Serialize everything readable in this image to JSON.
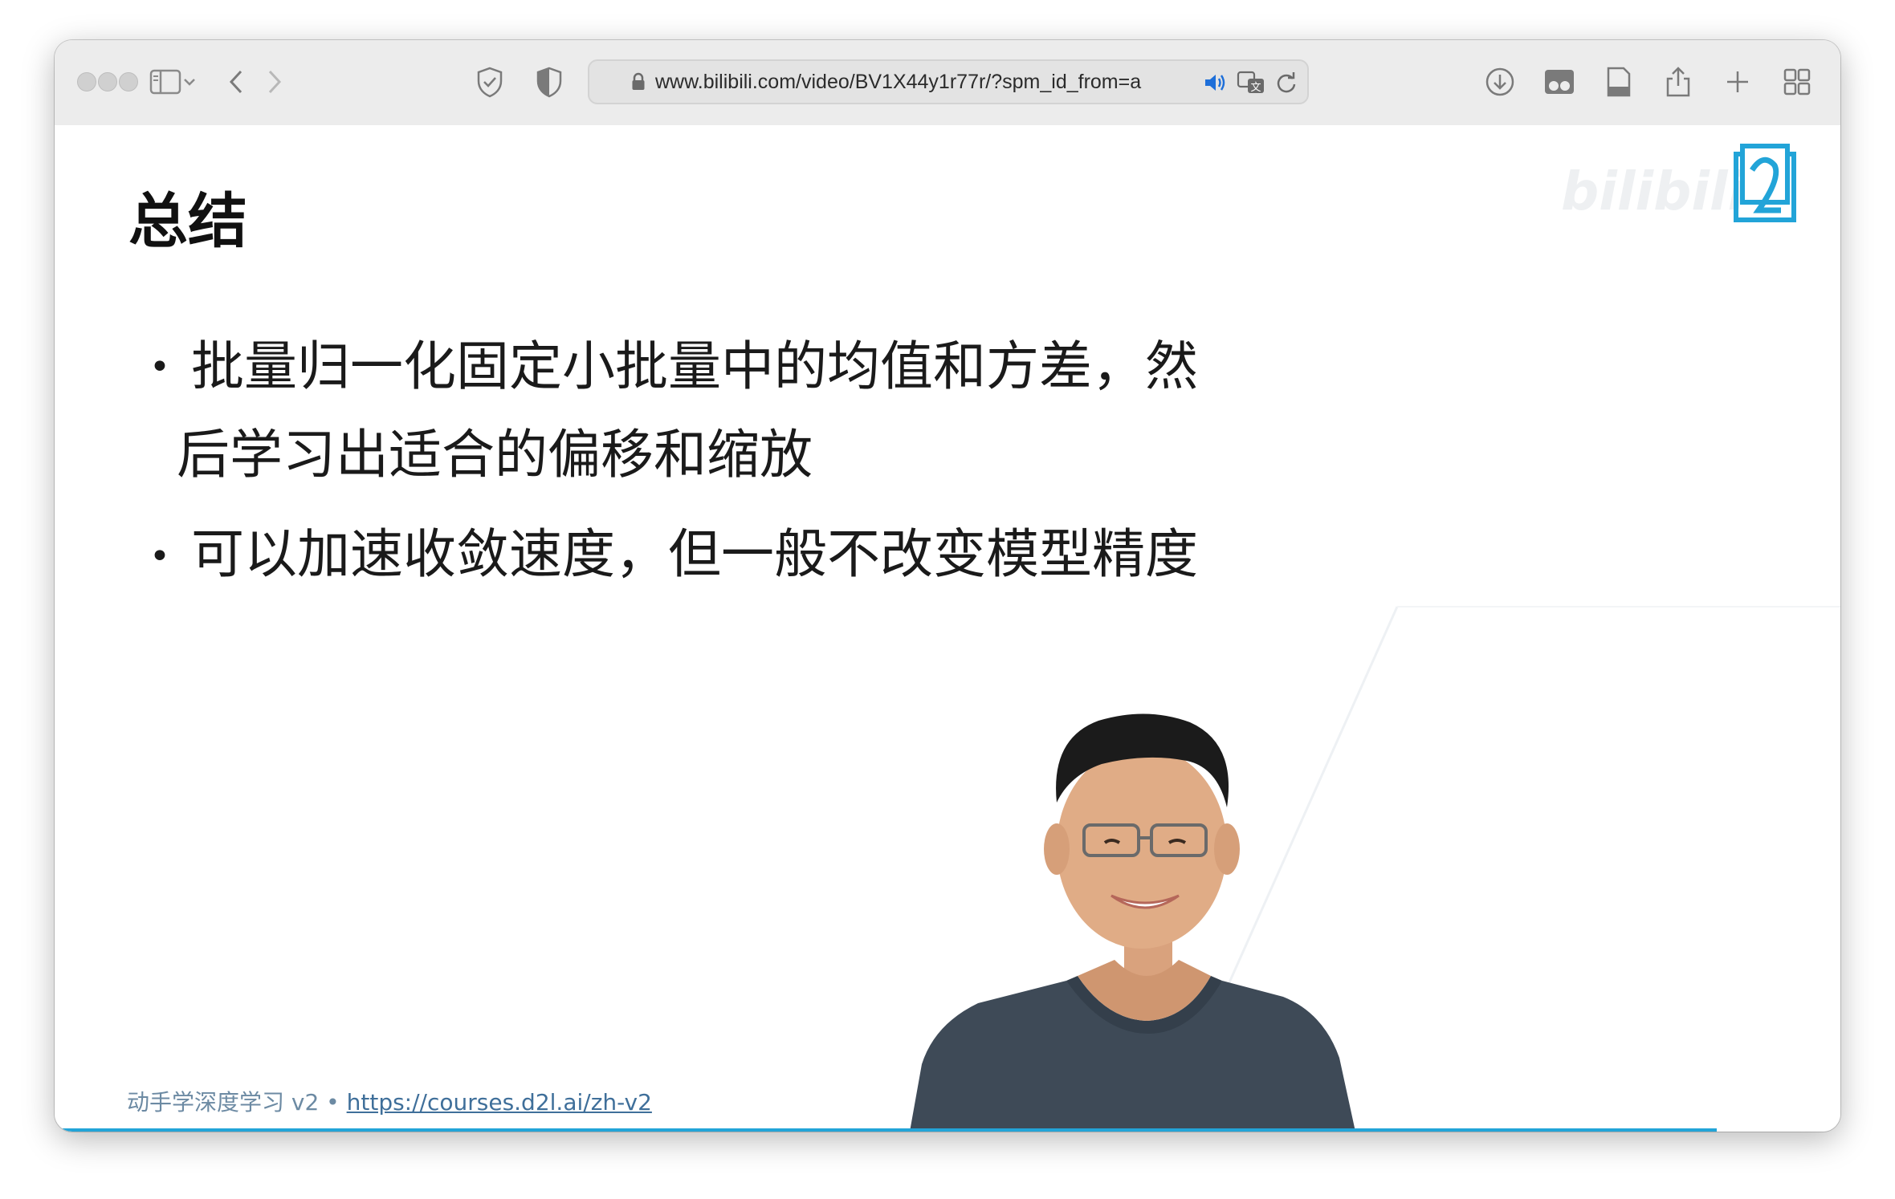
{
  "browser": {
    "url": "www.bilibili.com/video/BV1X44y1r77r/?spm_id_from=a",
    "icons": [
      "sidebar-icon",
      "chevron-down-icon",
      "back-icon",
      "forward-icon",
      "privacy-shield-icon",
      "extension-shield-icon",
      "lock-icon",
      "speaker-icon",
      "translate-icon",
      "reload-icon",
      "download-icon",
      "reader-icon",
      "page-icon",
      "share-icon",
      "new-tab-icon",
      "tab-overview-icon"
    ]
  },
  "slide": {
    "title": "总结",
    "bullets": [
      {
        "line1": "批量归一化固定小批量中的均值和方差，然",
        "line2": "后学习出适合的偏移和缩放"
      },
      {
        "line1": "可以加速收敛速度，但一般不改变模型精度"
      }
    ],
    "footer_prefix": "动手学深度学习 v2 • ",
    "footer_link": "https://courses.d2l.ai/zh-v2",
    "watermark": "bilibili"
  },
  "colors": {
    "accent": "#22a4d8",
    "toolbar_bg": "#ececec",
    "footer_text": "#6c8aa3",
    "shirt": "#3e4a57"
  }
}
